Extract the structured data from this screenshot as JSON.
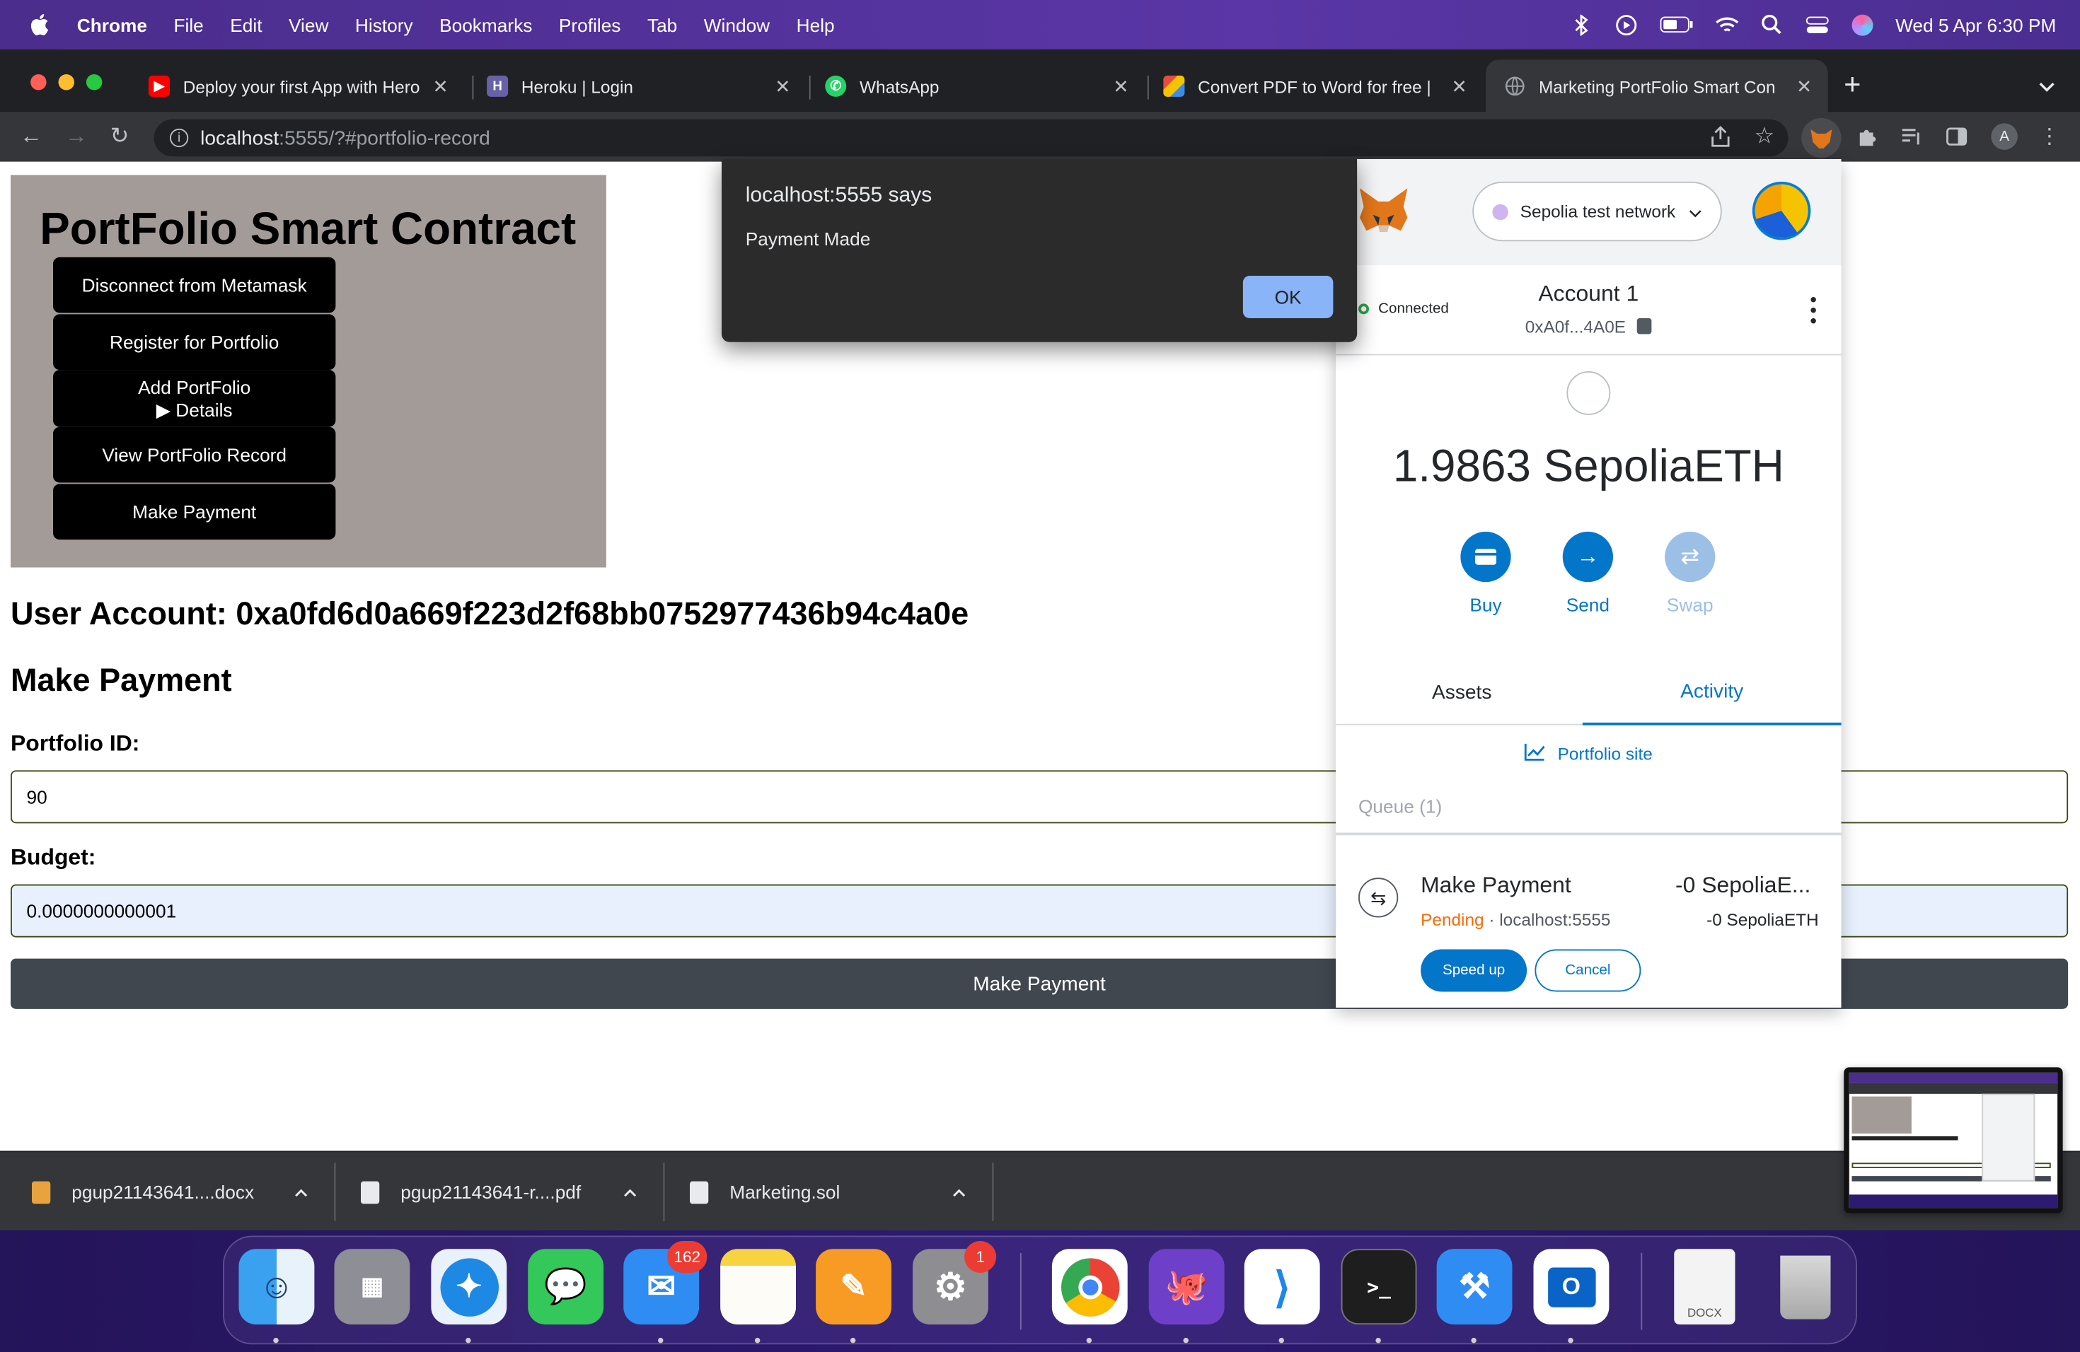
{
  "menubar": {
    "app_name": "Chrome",
    "menus": [
      "File",
      "Edit",
      "View",
      "History",
      "Bookmarks",
      "Profiles",
      "Tab",
      "Window",
      "Help"
    ],
    "datetime": "Wed 5 Apr  6:30 PM"
  },
  "tabs": [
    {
      "title": "Deploy your first App with Hero",
      "favicon": "youtube-icon",
      "color": "#ff0000"
    },
    {
      "title": "Heroku | Login",
      "favicon": "heroku-icon",
      "color": "#6762a6"
    },
    {
      "title": "WhatsApp",
      "favicon": "whatsapp-icon",
      "color": "#25d366"
    },
    {
      "title": "Convert PDF to Word for free |",
      "favicon": "pdf-converter-icon",
      "color": "#e84c3d"
    },
    {
      "title": "Marketing PortFolio Smart Con",
      "favicon": "globe-icon",
      "color": "#9aa0a6"
    }
  ],
  "address": {
    "host": "localhost",
    "path": ":5555/?#portfolio-record"
  },
  "page": {
    "hero_title": "PortFolio Smart Contract",
    "buttons": [
      "Disconnect from Metamask",
      "Register for Portfolio",
      "Add PortFolio",
      "▶ Details",
      "View PortFolio Record",
      "Make Payment"
    ],
    "user_account": "User Account: 0xa0fd6d0a669f223d2f68bb0752977436b94c4a0e",
    "section_heading": "Make Payment",
    "portfolio_id_label": "Portfolio ID:",
    "portfolio_id_value": "90",
    "budget_label": "Budget:",
    "budget_value": "0.0000000000001",
    "submit_label": "Make Payment"
  },
  "alert": {
    "title": "localhost:5555 says",
    "message": "Payment Made",
    "ok_label": "OK"
  },
  "metamask": {
    "network": "Sepolia test network",
    "connection_status": "Connected",
    "account_name": "Account 1",
    "account_address": "0xA0f...4A0E",
    "balance": "1.9863 SepoliaETH",
    "actions": [
      "Buy",
      "Send",
      "Swap"
    ],
    "tabs": [
      "Assets",
      "Activity"
    ],
    "site_link": "Portfolio site",
    "queue_label": "Queue (1)",
    "tx": {
      "title": "Make Payment",
      "amount": "-0 SepoliaE...",
      "status": "Pending",
      "origin": " · localhost:5555",
      "amount_secondary": "-0 SepoliaETH",
      "speed_up": "Speed up",
      "cancel": "Cancel"
    }
  },
  "downloads": [
    {
      "name": "pgup21143641....docx",
      "color": "#e8a33d"
    },
    {
      "name": "pgup21143641-r....pdf",
      "color": "#e8eaed"
    },
    {
      "name": "Marketing.sol",
      "color": "#e8eaed"
    }
  ],
  "dock": {
    "mail_badge": "162",
    "settings_badge": "1",
    "docx_label": "DOCX"
  }
}
